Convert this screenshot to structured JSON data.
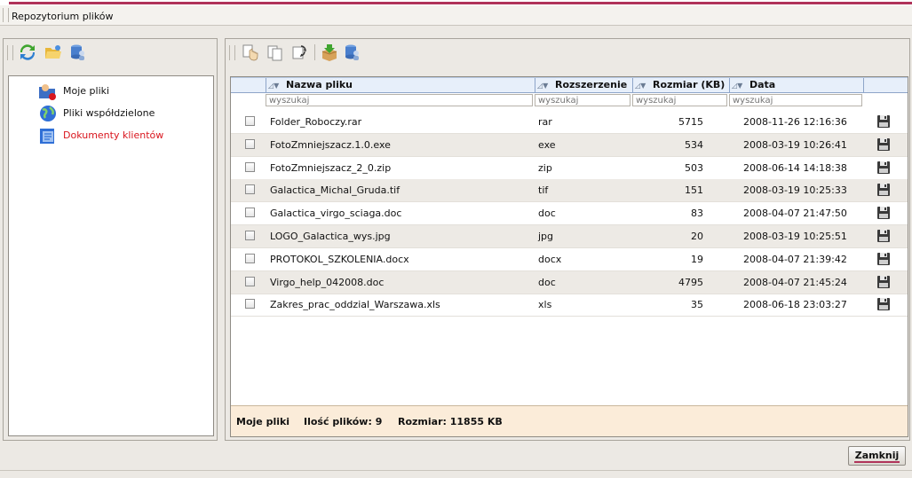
{
  "window": {
    "title": "Repozytorium plików"
  },
  "accent_color": "#b0335a",
  "left_toolbar": {
    "icons": [
      "refresh-icon",
      "open-folder-icon",
      "database-user-icon"
    ]
  },
  "right_toolbar": {
    "icons": [
      "touch-hand-icon",
      "copy-icon",
      "rename-icon",
      "export-box-icon",
      "database-user-icon"
    ]
  },
  "tree": {
    "items": [
      {
        "label": "Moje pliki",
        "icon": "user-folder-icon",
        "active": false
      },
      {
        "label": "Pliki współdzielone",
        "icon": "globe-icon",
        "active": false
      },
      {
        "label": "Dokumenty klientów",
        "icon": "client-documents-icon",
        "active": true
      }
    ]
  },
  "grid": {
    "columns": [
      "Nazwa pliku",
      "Rozszerzenie",
      "Rozmiar (KB)",
      "Data"
    ],
    "filter_placeholder": "wyszukaj",
    "rows": [
      {
        "name": "Folder_Roboczy.rar",
        "ext": "rar",
        "size": "5715",
        "date": "2008-11-26 12:16:36"
      },
      {
        "name": "FotoZmniejszacz.1.0.exe",
        "ext": "exe",
        "size": "534",
        "date": "2008-03-19 10:26:41"
      },
      {
        "name": "FotoZmniejszacz_2_0.zip",
        "ext": "zip",
        "size": "503",
        "date": "2008-06-14 14:18:38"
      },
      {
        "name": "Galactica_Michal_Gruda.tif",
        "ext": "tif",
        "size": "151",
        "date": "2008-03-19 10:25:33"
      },
      {
        "name": "Galactica_virgo_sciaga.doc",
        "ext": "doc",
        "size": "83",
        "date": "2008-04-07 21:47:50"
      },
      {
        "name": "LOGO_Galactica_wys.jpg",
        "ext": "jpg",
        "size": "20",
        "date": "2008-03-19 10:25:51"
      },
      {
        "name": "PROTOKOL_SZKOLENIA.docx",
        "ext": "docx",
        "size": "19",
        "date": "2008-04-07 21:39:42"
      },
      {
        "name": "Virgo_help_042008.doc",
        "ext": "doc",
        "size": "4795",
        "date": "2008-04-07 21:45:24"
      },
      {
        "name": "Zakres_prac_oddzial_Warszawa.xls",
        "ext": "xls",
        "size": "35",
        "date": "2008-06-18 23:03:27"
      }
    ]
  },
  "status": {
    "folder": "Moje pliki",
    "count_label": "Ilość plików: 9",
    "size_label": "Rozmiar: 11855 KB"
  },
  "footer": {
    "close_label": "Zamknij"
  }
}
